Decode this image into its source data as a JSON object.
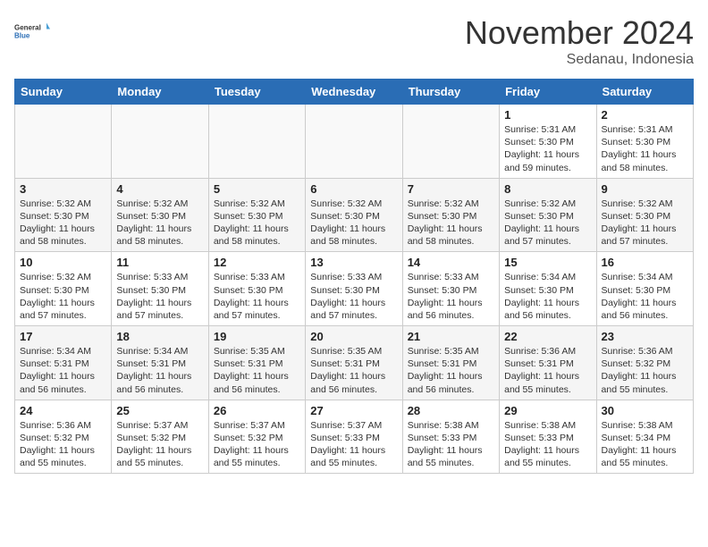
{
  "header": {
    "logo_general": "General",
    "logo_blue": "Blue",
    "month_title": "November 2024",
    "location": "Sedanau, Indonesia"
  },
  "days_of_week": [
    "Sunday",
    "Monday",
    "Tuesday",
    "Wednesday",
    "Thursday",
    "Friday",
    "Saturday"
  ],
  "weeks": [
    [
      {
        "day": "",
        "info": ""
      },
      {
        "day": "",
        "info": ""
      },
      {
        "day": "",
        "info": ""
      },
      {
        "day": "",
        "info": ""
      },
      {
        "day": "",
        "info": ""
      },
      {
        "day": "1",
        "info": "Sunrise: 5:31 AM\nSunset: 5:30 PM\nDaylight: 11 hours and 59 minutes."
      },
      {
        "day": "2",
        "info": "Sunrise: 5:31 AM\nSunset: 5:30 PM\nDaylight: 11 hours and 58 minutes."
      }
    ],
    [
      {
        "day": "3",
        "info": "Sunrise: 5:32 AM\nSunset: 5:30 PM\nDaylight: 11 hours and 58 minutes."
      },
      {
        "day": "4",
        "info": "Sunrise: 5:32 AM\nSunset: 5:30 PM\nDaylight: 11 hours and 58 minutes."
      },
      {
        "day": "5",
        "info": "Sunrise: 5:32 AM\nSunset: 5:30 PM\nDaylight: 11 hours and 58 minutes."
      },
      {
        "day": "6",
        "info": "Sunrise: 5:32 AM\nSunset: 5:30 PM\nDaylight: 11 hours and 58 minutes."
      },
      {
        "day": "7",
        "info": "Sunrise: 5:32 AM\nSunset: 5:30 PM\nDaylight: 11 hours and 58 minutes."
      },
      {
        "day": "8",
        "info": "Sunrise: 5:32 AM\nSunset: 5:30 PM\nDaylight: 11 hours and 57 minutes."
      },
      {
        "day": "9",
        "info": "Sunrise: 5:32 AM\nSunset: 5:30 PM\nDaylight: 11 hours and 57 minutes."
      }
    ],
    [
      {
        "day": "10",
        "info": "Sunrise: 5:32 AM\nSunset: 5:30 PM\nDaylight: 11 hours and 57 minutes."
      },
      {
        "day": "11",
        "info": "Sunrise: 5:33 AM\nSunset: 5:30 PM\nDaylight: 11 hours and 57 minutes."
      },
      {
        "day": "12",
        "info": "Sunrise: 5:33 AM\nSunset: 5:30 PM\nDaylight: 11 hours and 57 minutes."
      },
      {
        "day": "13",
        "info": "Sunrise: 5:33 AM\nSunset: 5:30 PM\nDaylight: 11 hours and 57 minutes."
      },
      {
        "day": "14",
        "info": "Sunrise: 5:33 AM\nSunset: 5:30 PM\nDaylight: 11 hours and 56 minutes."
      },
      {
        "day": "15",
        "info": "Sunrise: 5:34 AM\nSunset: 5:30 PM\nDaylight: 11 hours and 56 minutes."
      },
      {
        "day": "16",
        "info": "Sunrise: 5:34 AM\nSunset: 5:30 PM\nDaylight: 11 hours and 56 minutes."
      }
    ],
    [
      {
        "day": "17",
        "info": "Sunrise: 5:34 AM\nSunset: 5:31 PM\nDaylight: 11 hours and 56 minutes."
      },
      {
        "day": "18",
        "info": "Sunrise: 5:34 AM\nSunset: 5:31 PM\nDaylight: 11 hours and 56 minutes."
      },
      {
        "day": "19",
        "info": "Sunrise: 5:35 AM\nSunset: 5:31 PM\nDaylight: 11 hours and 56 minutes."
      },
      {
        "day": "20",
        "info": "Sunrise: 5:35 AM\nSunset: 5:31 PM\nDaylight: 11 hours and 56 minutes."
      },
      {
        "day": "21",
        "info": "Sunrise: 5:35 AM\nSunset: 5:31 PM\nDaylight: 11 hours and 56 minutes."
      },
      {
        "day": "22",
        "info": "Sunrise: 5:36 AM\nSunset: 5:31 PM\nDaylight: 11 hours and 55 minutes."
      },
      {
        "day": "23",
        "info": "Sunrise: 5:36 AM\nSunset: 5:32 PM\nDaylight: 11 hours and 55 minutes."
      }
    ],
    [
      {
        "day": "24",
        "info": "Sunrise: 5:36 AM\nSunset: 5:32 PM\nDaylight: 11 hours and 55 minutes."
      },
      {
        "day": "25",
        "info": "Sunrise: 5:37 AM\nSunset: 5:32 PM\nDaylight: 11 hours and 55 minutes."
      },
      {
        "day": "26",
        "info": "Sunrise: 5:37 AM\nSunset: 5:32 PM\nDaylight: 11 hours and 55 minutes."
      },
      {
        "day": "27",
        "info": "Sunrise: 5:37 AM\nSunset: 5:33 PM\nDaylight: 11 hours and 55 minutes."
      },
      {
        "day": "28",
        "info": "Sunrise: 5:38 AM\nSunset: 5:33 PM\nDaylight: 11 hours and 55 minutes."
      },
      {
        "day": "29",
        "info": "Sunrise: 5:38 AM\nSunset: 5:33 PM\nDaylight: 11 hours and 55 minutes."
      },
      {
        "day": "30",
        "info": "Sunrise: 5:38 AM\nSunset: 5:34 PM\nDaylight: 11 hours and 55 minutes."
      }
    ]
  ]
}
